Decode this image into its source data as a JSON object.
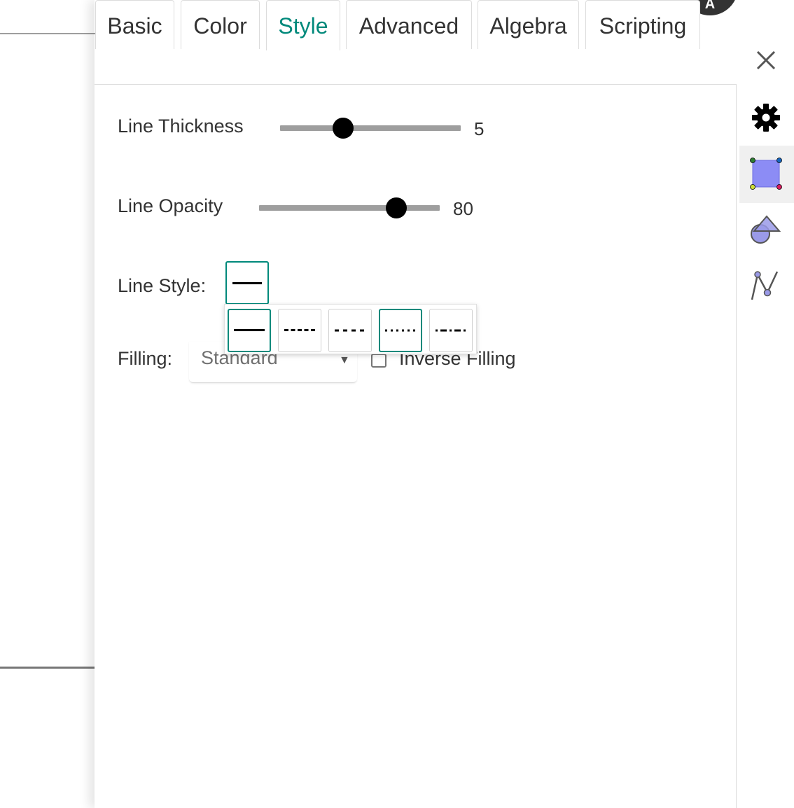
{
  "tabs": [
    {
      "label": "Basic"
    },
    {
      "label": "Color"
    },
    {
      "label": "Style"
    },
    {
      "label": "Advanced"
    },
    {
      "label": "Algebra"
    },
    {
      "label": "Scripting"
    }
  ],
  "active_tab": "Style",
  "accent_color": "#00897b",
  "style": {
    "line_thickness": {
      "label": "Line Thickness",
      "value": "5",
      "fraction": 0.35
    },
    "line_opacity": {
      "label": "Line Opacity",
      "value": "80",
      "fraction": 0.76
    },
    "line_style": {
      "label": "Line Style:",
      "selected": "solid",
      "options": [
        "solid",
        "dashed-long",
        "dashed-short",
        "dotted",
        "dash-dot"
      ]
    },
    "filling": {
      "label": "Filling:",
      "value": "Standard",
      "inverse_label": "Inverse Filling",
      "inverse_checked": false
    }
  },
  "sidebar_icons": [
    "close-icon",
    "gear-icon",
    "polygon-icon",
    "shapes-icon",
    "function-graph-icon"
  ]
}
